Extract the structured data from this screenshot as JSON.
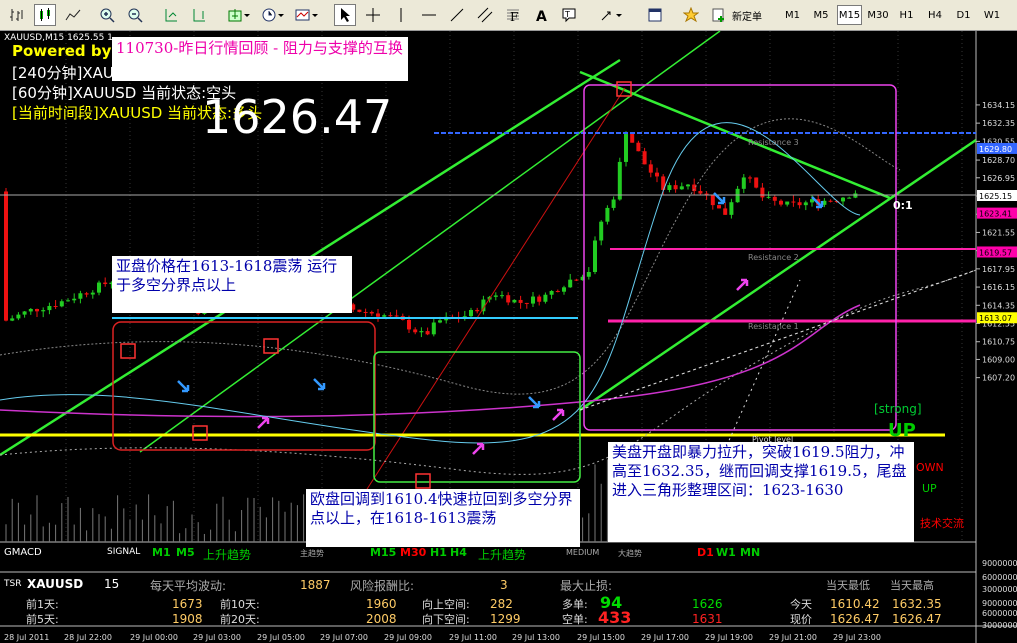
{
  "toolbar": {
    "new_order_label": "新定单",
    "timeframes": [
      "M1",
      "M5",
      "M15",
      "M30",
      "H1",
      "H4",
      "D1",
      "W1"
    ],
    "active_timeframe": "M15"
  },
  "chart_header": {
    "symbol_info": "XAUUSD,M15  1625.55 1",
    "powered_by": "Powered by",
    "status_240": "[240分钟]XAU",
    "status_60": "[60分钟]XAUUSD 当前状态:空头",
    "status_current": "[当前时间段]XAUUSD 当前状态:多头",
    "big_price": "1626.47"
  },
  "notes": {
    "title": "110730-昨日行情回顾 - 阻力与支撑的互换",
    "asia": "亚盘价格在1613-1618震荡 运行于多空分界点以上",
    "europe": "欧盘回调到1610.4快速拉回到多空分界点以上，在1618-1613震荡",
    "us": "美盘开盘即暴力拉升，突破1619.5阻力，冲高至1632.35，继而回调支撑1619.5，尾盘进入三角形整理区间：1623-1630"
  },
  "chart_labels": {
    "resistance_3": "Resistance 3",
    "resistance_2": "Resistance 2",
    "resistance_1": "Resistance 1",
    "pivot": "Pivot level",
    "ratio": "0:1",
    "strong": "[strong]",
    "up_big": "UP",
    "down": "OWN",
    "up_small": "UP",
    "tech_exchange": "技术交流"
  },
  "price_axis": {
    "labels": [
      "1634.15",
      "1632.35",
      "1630.55",
      "1628.70",
      "1626.95",
      "1625.15",
      "1623.35",
      "1621.55",
      "1619.75",
      "1617.95",
      "1616.15",
      "1614.35",
      "1612.55",
      "1610.75",
      "1609.00",
      "1607.20"
    ],
    "tag_1629": "1629.80",
    "tag_current": "1625.15",
    "tag_1623": "1623.41",
    "tag_1619": "1619.57",
    "tag_1613": "1613.07",
    "sub_labels": [
      "9000000",
      "6000000",
      "3000000",
      "9000000",
      "6000000",
      "3000000"
    ]
  },
  "indicator_bar": {
    "gmacd": "GMACD",
    "signal": "SIGNAL",
    "m1": "M1",
    "m5": "M5",
    "trend_left": "上升趋势",
    "main_trend": "主趋势",
    "m15": "M15",
    "m30": "M30",
    "h1": "H1",
    "h4": "H4",
    "trend_mid": "上升趋势",
    "medium": "MEDIUM",
    "big_trend": "大趋势",
    "d1": "D1",
    "w1": "W1",
    "mn": "MN"
  },
  "stats": {
    "tsr": "TSR",
    "symbol": "XAUUSD",
    "period": "15",
    "avg_range_label": "每天平均波动:",
    "avg_range_value": "1887",
    "risk_reward_label": "风险报酬比:",
    "risk_reward_value": "3",
    "max_stop_label": "最大止损:",
    "yday_low_label": "当天最低",
    "yday_high_label": "当天最高",
    "prev1_label": "前1天:",
    "prev1_value": "1673",
    "prev10_label": "前10天:",
    "prev10_value": "1960",
    "up_space_label": "向上空间:",
    "up_space_value": "282",
    "long_label": "多单:",
    "long_value": "94",
    "long_price": "1626",
    "today_label": "今天",
    "today_low": "1610.42",
    "today_high": "1632.35",
    "prev5_label": "前5天:",
    "prev5_value": "1908",
    "prev20_label": "前20天:",
    "prev20_value": "2008",
    "down_space_label": "向下空间:",
    "down_space_value": "1299",
    "short_label": "空单:",
    "short_value": "433",
    "short_price": "1631",
    "current_label": "现价",
    "current_low": "1626.47",
    "current_high": "1626.47"
  },
  "time_axis": [
    "28 Jul 2011",
    "28 Jul 22:00",
    "29 Jul 00:00",
    "29 Jul 03:00",
    "29 Jul 05:00",
    "29 Jul 07:00",
    "29 Jul 09:00",
    "29 Jul 11:00",
    "29 Jul 13:00",
    "29 Jul 15:00",
    "29 Jul 17:00",
    "29 Jul 19:00",
    "29 Jul 21:00",
    "29 Jul 23:00"
  ]
}
